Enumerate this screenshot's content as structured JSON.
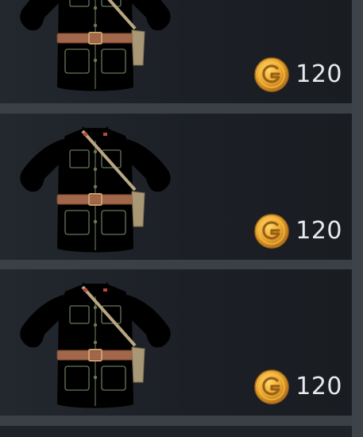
{
  "items": [
    {
      "price": "120",
      "currency_icon": "gold-coin-icon",
      "item_icon": "green-uniform-jacket"
    },
    {
      "price": "120",
      "currency_icon": "gold-coin-icon",
      "item_icon": "pale-uniform-jacket"
    },
    {
      "price": "120",
      "currency_icon": "gold-coin-icon",
      "item_icon": "pale-uniform-jacket"
    }
  ],
  "colors": {
    "panel": "#1e2228",
    "separator": "#3b4046",
    "coin": "#e0a12a",
    "price_text": "#e8ebee"
  }
}
